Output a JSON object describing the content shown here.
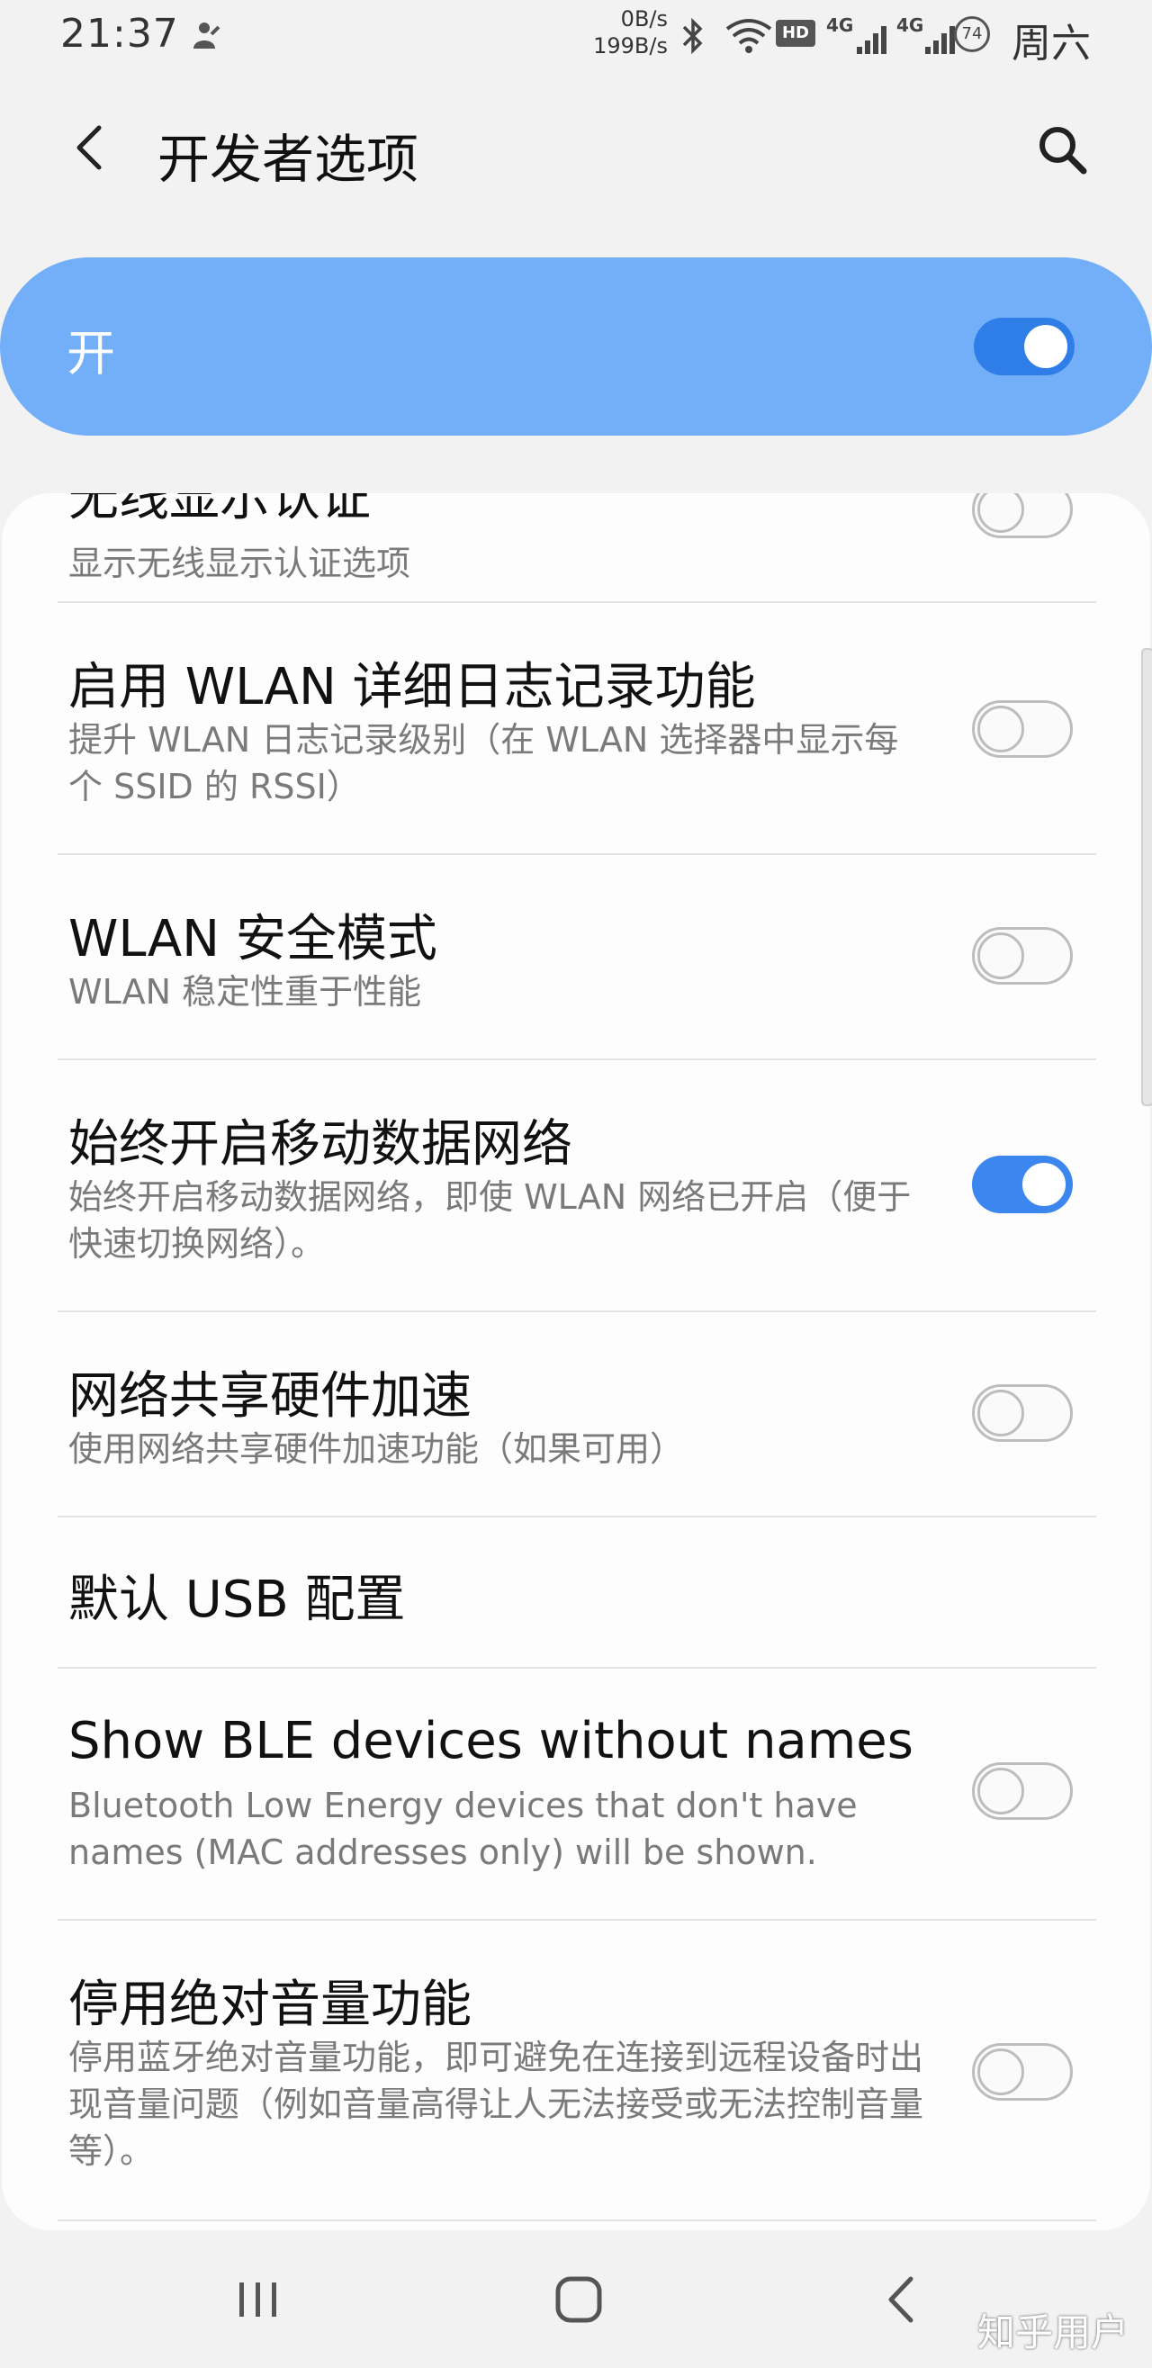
{
  "status_bar": {
    "time": "21:37",
    "net_down": "0B/s",
    "net_up": "199B/s",
    "hd_badge": "HD",
    "lte_label_1": "4G",
    "lte_label_2": "4G",
    "battery": "74",
    "day": "周六",
    "icons": [
      "notification-icon",
      "bluetooth-icon",
      "wifi-icon",
      "signal-icon",
      "battery-icon"
    ]
  },
  "app_bar": {
    "title": "开发者选项"
  },
  "master_switch": {
    "label": "开",
    "state": "on"
  },
  "settings": [
    {
      "title": "无线显示认证",
      "subtitle": "显示无线显示认证选项",
      "toggle": "off"
    },
    {
      "title": "启用 WLAN 详细日志记录功能",
      "subtitle": "提升 WLAN 日志记录级别（在 WLAN 选择器中显示每个 SSID 的 RSSI）",
      "toggle": "off"
    },
    {
      "title": "WLAN 安全模式",
      "subtitle": "WLAN 稳定性重于性能",
      "toggle": "off"
    },
    {
      "title": "始终开启移动数据网络",
      "subtitle": "始终开启移动数据网络，即使 WLAN 网络已开启（便于快速切换网络）。",
      "toggle": "on"
    },
    {
      "title": "网络共享硬件加速",
      "subtitle": "使用网络共享硬件加速功能（如果可用）",
      "toggle": "off"
    },
    {
      "title": "默认 USB 配置",
      "subtitle": "",
      "toggle": "none"
    },
    {
      "title": "Show BLE devices without names",
      "subtitle": "Bluetooth Low Energy devices that don't have names (MAC addresses only) will be shown.",
      "toggle": "off"
    },
    {
      "title": "停用绝对音量功能",
      "subtitle": "停用蓝牙绝对音量功能，即可避免在连接到远程设备时出现音量问题（例如音量高得让人无法接受或无法控制音量等）。",
      "toggle": "off"
    }
  ],
  "nav_bar": {
    "watermark": "知乎用户"
  },
  "colors": {
    "accent": "#3b86ef",
    "master_bar": "#72aff8",
    "background": "#f2f2f2",
    "card": "#fdfdfd",
    "subtitle": "#7a7a7a"
  }
}
